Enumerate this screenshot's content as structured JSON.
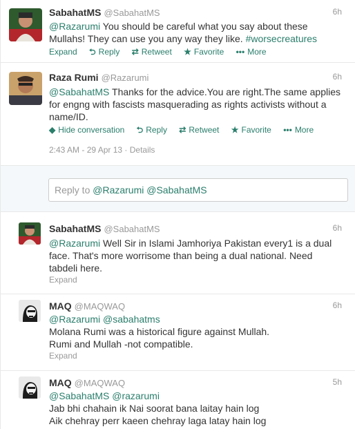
{
  "tweets": [
    {
      "fullname": "SabahatMS",
      "screenname": "@SabahatMS",
      "time": "6h",
      "text_mention": "@Razarumi",
      "text_body": " You should be careful what you say about these Mullahs! They can use you any way they like. ",
      "text_hashtag": "#worsecreatures",
      "actions": {
        "expand": "Expand",
        "reply": "Reply",
        "retweet": "Retweet",
        "favorite": "Favorite",
        "more": "More"
      }
    },
    {
      "fullname": "Raza Rumi",
      "screenname": "@Razarumi",
      "time": "6h",
      "text_mention": "@SabahatMS",
      "text_body": " Thanks for the advice.You are right.The same applies for engng with fascists masquerading as rights activists without a name/ID.",
      "actions": {
        "hide": "Hide conversation",
        "reply": "Reply",
        "retweet": "Retweet",
        "favorite": "Favorite",
        "more": "More"
      },
      "timestamp": "2:43 AM - 29 Apr 13",
      "details": "Details"
    }
  ],
  "reply_box": {
    "prefix": "Reply to ",
    "mentions": "@Razarumi @SabahatMS"
  },
  "replies": [
    {
      "fullname": "SabahatMS",
      "screenname": "@SabahatMS",
      "time": "6h",
      "text_mention": "@Razarumi",
      "text_body": " Well Sir in Islami Jamhoriya Pakistan every1 is a dual face. That's more worrisome than being a dual national. Need tabdeli here.",
      "expand": "Expand"
    },
    {
      "fullname": "MAQ",
      "screenname": "@MAQWAQ",
      "time": "6h",
      "text_mention": "@Razarumi @sabahatms",
      "line1": "Molana Rumi was a historical figure against Mullah.",
      "line2": "Rumi and Mullah  -not compatible.",
      "expand": "Expand"
    },
    {
      "fullname": "MAQ",
      "screenname": "@MAQWAQ",
      "time": "5h",
      "text_mention": "@SabahatMS @razarumi",
      "line1": "Jab bhi chahain ik Nai soorat bana laitay hain log",
      "line2": "Aik chehray perr kaeen chehray laga latay hain log"
    }
  ],
  "colors": {
    "link": "#2a7e6b",
    "muted": "#999999",
    "text": "#333333",
    "border": "#e8e8e8"
  }
}
